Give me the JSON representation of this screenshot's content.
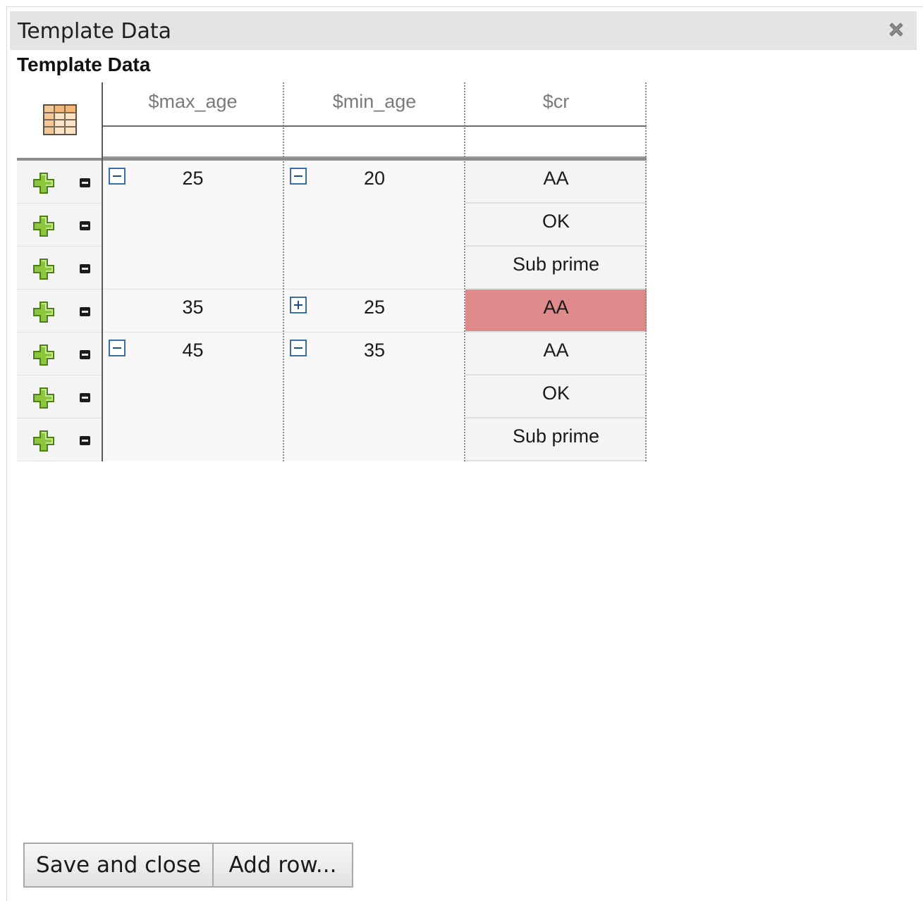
{
  "window": {
    "title": "Template Data",
    "close_icon": "close-icon"
  },
  "section": {
    "title": "Template Data"
  },
  "grid": {
    "corner_icon": "table-icon",
    "columns": [
      "$max_age",
      "$min_age",
      "$cr"
    ],
    "max_age_groups": [
      "25",
      "35",
      "45"
    ],
    "min_age_groups": [
      "20",
      "25",
      "35"
    ],
    "cr_values": [
      "AA",
      "OK",
      "Sub prime",
      "AA",
      "AA",
      "OK",
      "Sub prime"
    ],
    "highlight_color": "#de8a8a",
    "row_controls": {
      "add_icon": "plus-icon",
      "delete_icon": "minus-icon"
    }
  },
  "buttons": {
    "save": "Save and close",
    "add_row": "Add row..."
  }
}
